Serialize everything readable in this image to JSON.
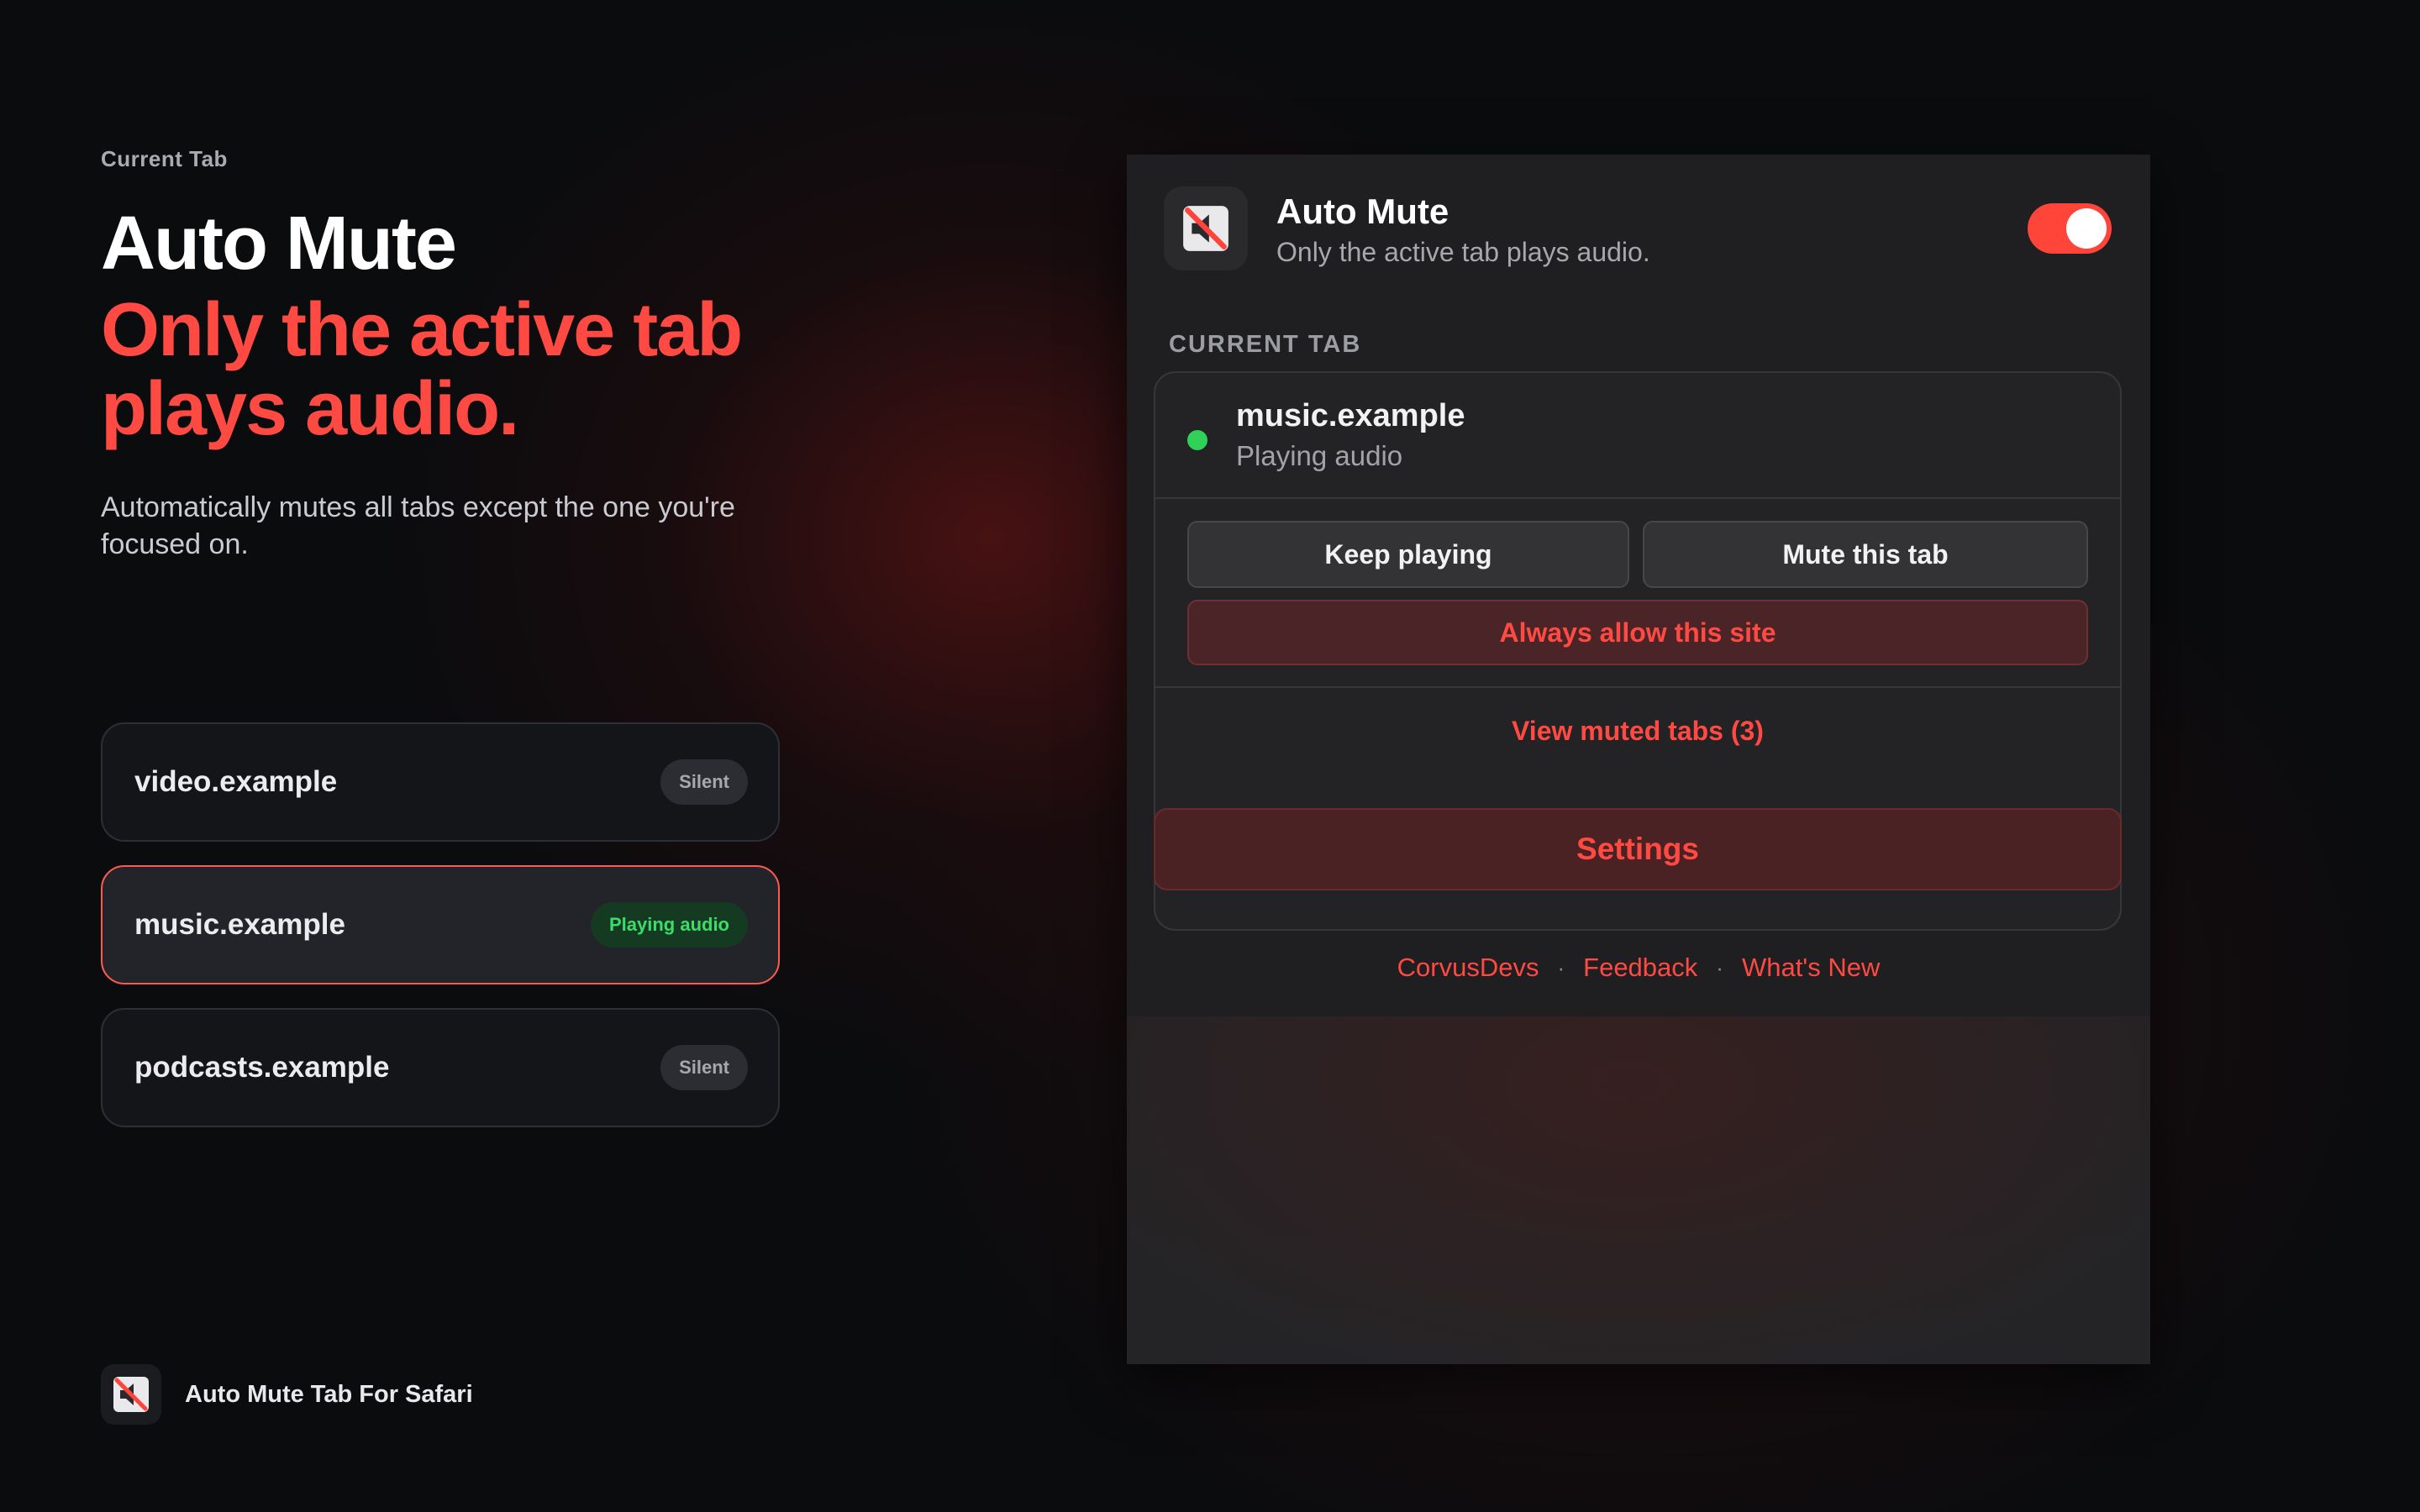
{
  "hero": {
    "eyebrow": "Current Tab",
    "title": "Auto Mute",
    "accent": "Only the active tab plays audio.",
    "description": "Automatically mutes all tabs except the one you're focused on."
  },
  "sites": [
    {
      "name": "video.example",
      "status": "Silent"
    },
    {
      "name": "music.example",
      "status": "Playing audio"
    },
    {
      "name": "podcasts.example",
      "status": "Silent"
    }
  ],
  "brand": {
    "name": "Auto Mute Tab For Safari",
    "icon": "muted-speaker-icon"
  },
  "popup": {
    "title": "Auto Mute",
    "subtitle": "Only the active tab plays audio.",
    "enabled": true,
    "section_label": "CURRENT TAB",
    "current_tab": {
      "host": "music.example",
      "state": "Playing audio"
    },
    "keep_playing_label": "Keep playing",
    "mute_tab_label": "Mute this tab",
    "always_allow_label": "Always allow this site",
    "view_muted_label": "View muted tabs (3)",
    "settings_label": "Settings",
    "footer_links": [
      "CorvusDevs",
      "Feedback",
      "What's New"
    ],
    "footer_separator": "·"
  },
  "colors": {
    "accent": "#ff453a",
    "playing": "#30d158",
    "background": "#0b0c0e"
  }
}
